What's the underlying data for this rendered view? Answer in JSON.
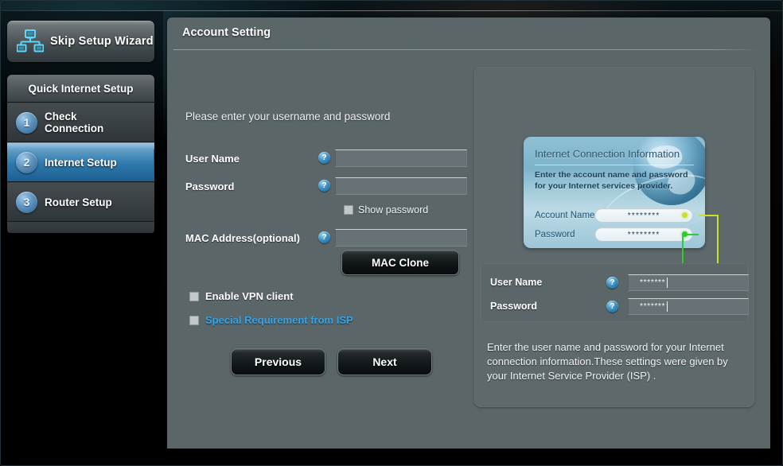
{
  "sidebar": {
    "skip_button": {
      "label": "Skip Setup Wizard",
      "icon": "network-topology-icon"
    },
    "qis_header": "Quick Internet Setup",
    "steps": [
      {
        "num": "1",
        "label": "Check\nConnection",
        "active": false
      },
      {
        "num": "2",
        "label": "Internet Setup",
        "active": true
      },
      {
        "num": "3",
        "label": "Router Setup",
        "active": false
      }
    ]
  },
  "main": {
    "title": "Account Setting",
    "intro": "Please enter your username and password",
    "fields": {
      "username": {
        "label": "User Name",
        "value": "",
        "help": "?"
      },
      "password": {
        "label": "Password",
        "value": "",
        "help": "?"
      },
      "mac": {
        "label": "MAC Address(optional)",
        "value": "",
        "help": "?"
      }
    },
    "show_password": {
      "label": "Show password",
      "checked": false
    },
    "mac_clone_button": "MAC Clone",
    "options": [
      {
        "label": "Enable VPN client",
        "checked": false,
        "accent": false
      },
      {
        "label": "Special Requirement from ISP",
        "checked": false,
        "accent": true
      }
    ],
    "nav": {
      "previous": "Previous",
      "next": "Next"
    }
  },
  "help": {
    "card": {
      "title": "Internet Connection Information",
      "subtitle": "Enter the account name and password for your Internet services provider.",
      "rows": [
        {
          "label": "Account Name",
          "value": "********",
          "dot": "yellow"
        },
        {
          "label": "Password",
          "value": "********",
          "dot": "green"
        }
      ]
    },
    "mini_form": [
      {
        "label": "User Name",
        "help": "?",
        "value": "*******"
      },
      {
        "label": "Password",
        "help": "?",
        "value": "*******"
      }
    ],
    "description": "Enter the user name and password for your Internet connection information.These settings were given by your Internet Service Provider (ISP) ."
  },
  "colors": {
    "panel_bg": "#5b6669",
    "accent_blue": "#36a5e8",
    "active_step": "#2d78ab",
    "dot_yellow": "#cbe02a",
    "dot_green": "#2ecc2e"
  }
}
